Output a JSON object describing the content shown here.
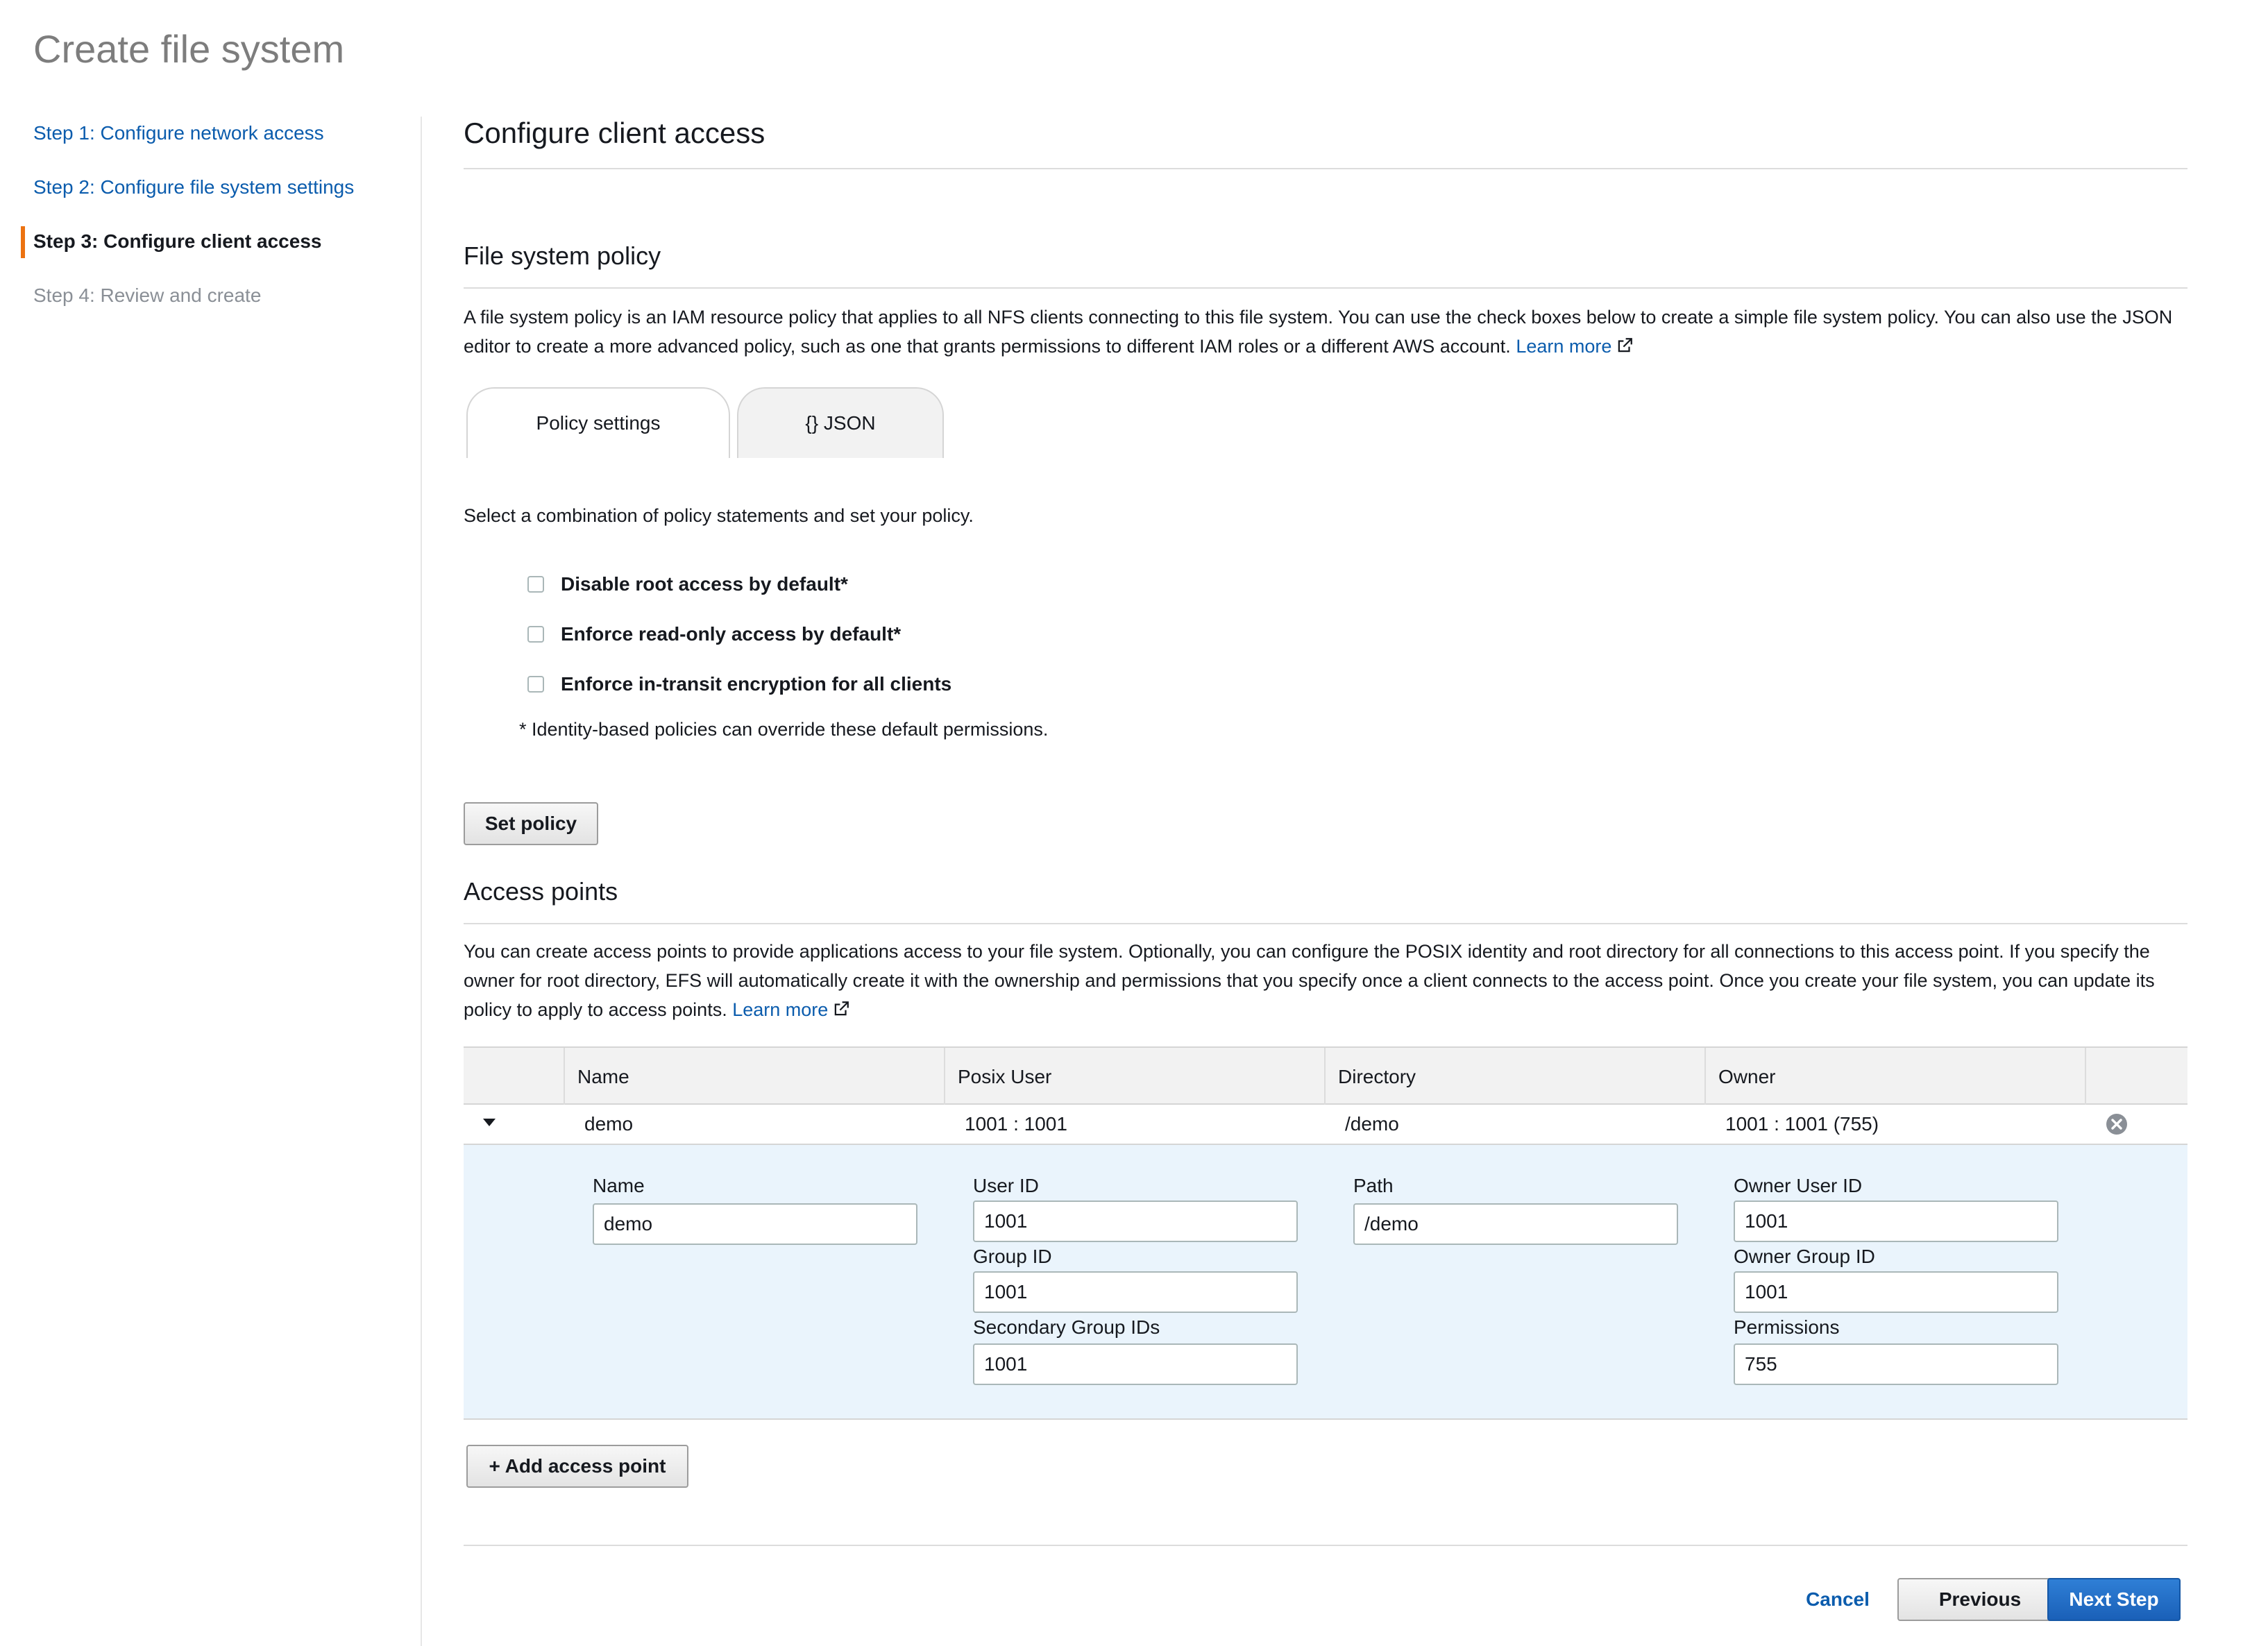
{
  "page_title": "Create file system",
  "steps": [
    {
      "label": "Step 1: Configure network access"
    },
    {
      "label": "Step 2: Configure file system settings"
    },
    {
      "label": "Step 3: Configure client access"
    },
    {
      "label": "Step 4: Review and create"
    }
  ],
  "section_title": "Configure client access",
  "file_system_policy": {
    "title": "File system policy",
    "description": "A file system policy is an IAM resource policy that applies to all NFS clients connecting to this file system. You can use the check boxes below to create a simple file system policy. You can also use the JSON editor to create a more advanced policy, such as one that grants permissions to different IAM roles or a different AWS account.",
    "learn_more": "Learn more",
    "tabs": [
      {
        "label": "Policy settings"
      },
      {
        "label": "{} JSON"
      }
    ],
    "instruction": "Select a combination of policy statements and set your policy.",
    "options": [
      {
        "label": "Disable root access by default*",
        "checked": false
      },
      {
        "label": "Enforce read-only access by default*",
        "checked": false
      },
      {
        "label": "Enforce in-transit encryption for all clients",
        "checked": false
      }
    ],
    "footnote": "* Identity-based policies can override these default permissions.",
    "set_policy_label": "Set policy"
  },
  "access_points": {
    "title": "Access points",
    "description": "You can create access points to provide applications access to your file system. Optionally, you can configure the POSIX identity and root directory for all connections to this access point. If you specify the owner for root directory, EFS will automatically create it with the ownership and permissions that you specify once a client connects to the access point. Once you create your file system, you can update its policy to apply to access points.",
    "learn_more": "Learn more",
    "columns": [
      "Name",
      "Posix User",
      "Directory",
      "Owner"
    ],
    "rows": [
      {
        "name": "demo",
        "posix_user": "1001 : 1001",
        "directory": "/demo",
        "owner": "1001 : 1001 (755)"
      }
    ],
    "detail": {
      "name_label": "Name",
      "name_value": "demo",
      "user_id_label": "User ID",
      "user_id_value": "1001",
      "group_id_label": "Group ID",
      "group_id_value": "1001",
      "secondary_group_ids_label": "Secondary Group IDs",
      "secondary_group_ids_value": "1001",
      "path_label": "Path",
      "path_value": "/demo",
      "owner_user_id_label": "Owner User ID",
      "owner_user_id_value": "1001",
      "owner_group_id_label": "Owner Group ID",
      "owner_group_id_value": "1001",
      "permissions_label": "Permissions",
      "permissions_value": "755"
    },
    "add_label": "+ Add access point"
  },
  "footer": {
    "cancel": "Cancel",
    "previous": "Previous",
    "next": "Next Step"
  },
  "colors": {
    "link": "#0b5cad",
    "accent": "#ec7211",
    "primary_button": "#1a60b8",
    "detail_bg": "#eaf4fc"
  }
}
